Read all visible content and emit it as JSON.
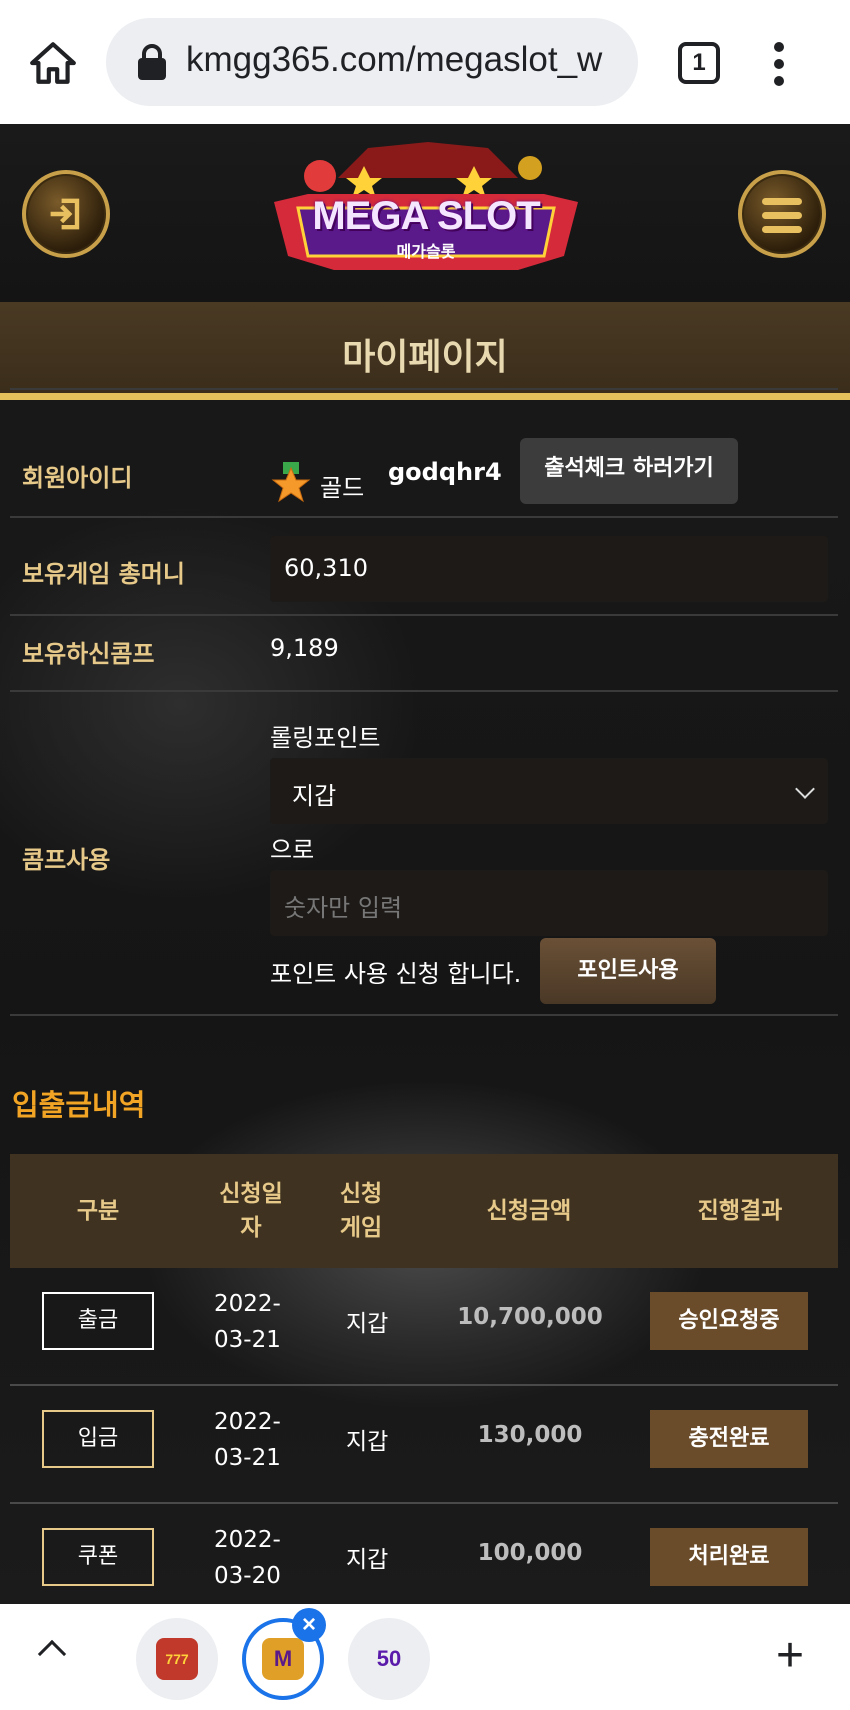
{
  "browser": {
    "url": "kmgg365.com/megaslot_w",
    "tab_count": "1"
  },
  "header": {
    "logo_text": "MEGA SLOT",
    "logo_subtext": "메가슬롯"
  },
  "page_title": "마이페이지",
  "member": {
    "id_label": "회원아이디",
    "grade": "골드",
    "user_id": "godqhr4",
    "attendance_button": "출석체크 하러가기"
  },
  "money": {
    "label": "보유게임 총머니",
    "value": "60,310"
  },
  "comp": {
    "label": "보유하신콤프",
    "value": "9,189"
  },
  "comp_use": {
    "label": "콤프사용",
    "rolling_label": "롤링포인트",
    "select_value": "지갑",
    "to_label": "으로",
    "amount_placeholder": "숫자만 입력",
    "apply_text": "포인트 사용 신청 합니다.",
    "use_button": "포인트사용"
  },
  "history": {
    "title": "입출금내역",
    "headers": [
      "구분",
      "신청일\n자",
      "신청\n게임",
      "신청금액",
      "진행결과"
    ],
    "rows": [
      {
        "type": "출금",
        "date": "2022-\n03-21",
        "game": "지갑",
        "amount": "10,700,000",
        "status": "승인요청중"
      },
      {
        "type": "입금",
        "date": "2022-\n03-21",
        "game": "지갑",
        "amount": "130,000",
        "status": "충전완료"
      },
      {
        "type": "쿠폰",
        "date": "2022-\n03-20",
        "game": "지갑",
        "amount": "100,000",
        "status": "처리완료"
      }
    ]
  },
  "bottom_tabs": {
    "tab2_letter": "M",
    "tab3_label": "50",
    "close_symbol": "×",
    "plus_symbol": "+"
  }
}
